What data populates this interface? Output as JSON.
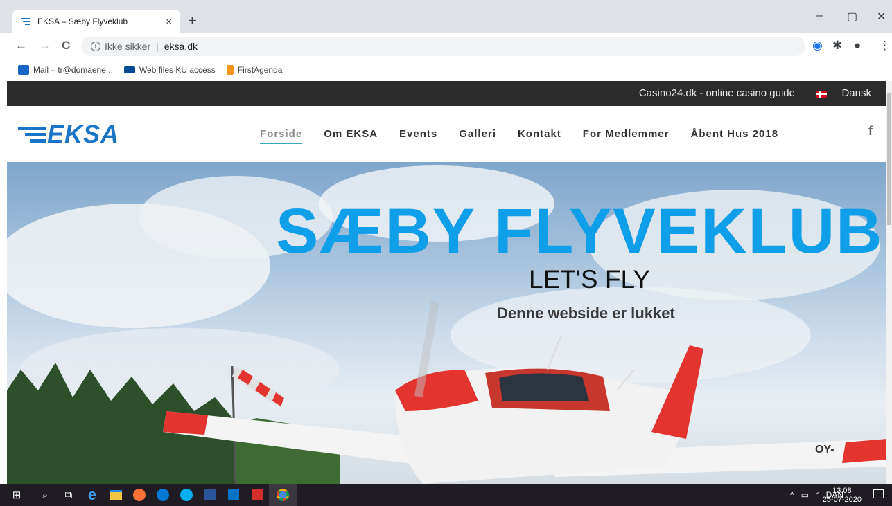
{
  "browser": {
    "tab_title": "EKSA – Sæby Flyveklub",
    "new_tab": "+",
    "close_tab": "×",
    "window_controls": {
      "minimize": "–",
      "restore": "▢",
      "close": "✕"
    },
    "nav": {
      "back": "←",
      "forward": "→",
      "reload": "C"
    },
    "address": {
      "security": "Ikke sikker",
      "separator": "|",
      "url": "eksa.dk"
    },
    "icons": {
      "bookmark_star": "☆",
      "extensions": "✱",
      "menu": "⋮",
      "profile": "●"
    },
    "bookmarks": [
      {
        "label": "Mail – tr@domaene...",
        "icon": "outlook-icon",
        "color": "#1a66c7"
      },
      {
        "label": "Web files KU access",
        "icon": "webfiles-icon",
        "color": "#004c97"
      },
      {
        "label": "FirstAgenda",
        "icon": "firstagenda-icon",
        "color": "#f7941d"
      }
    ]
  },
  "site": {
    "topbar": {
      "casino_link": "Casino24.dk - online casino guide",
      "language": "Dansk"
    },
    "logo_text": "EKSA",
    "nav": [
      "Forside",
      "Om EKSA",
      "Events",
      "Galleri",
      "Kontakt",
      "For Medlemmer",
      "Åbent Hus 2018"
    ],
    "social": "f",
    "hero": {
      "title": "SÆBY FLYVEKLUB",
      "tagline": "LET'S FLY",
      "notice": "Denne webside er lukket",
      "plane_registration": "OY-"
    }
  },
  "taskbar": {
    "apps": [
      "start-icon",
      "search-icon",
      "taskview-icon",
      "edge-icon",
      "explorer-icon",
      "firefox-icon",
      "skype-business-icon",
      "skype-icon",
      "word-icon",
      "outlook-icon",
      "acrobat-icon",
      "chrome-icon"
    ],
    "tray_language": "DAN",
    "time": "13:08",
    "date": "25-07-2020"
  },
  "colors": {
    "brand_blue": "#1a75c9",
    "hero_title": "#0f9ee8",
    "topbar": "#2b2b2b",
    "taskbar": "#1f1c24"
  }
}
